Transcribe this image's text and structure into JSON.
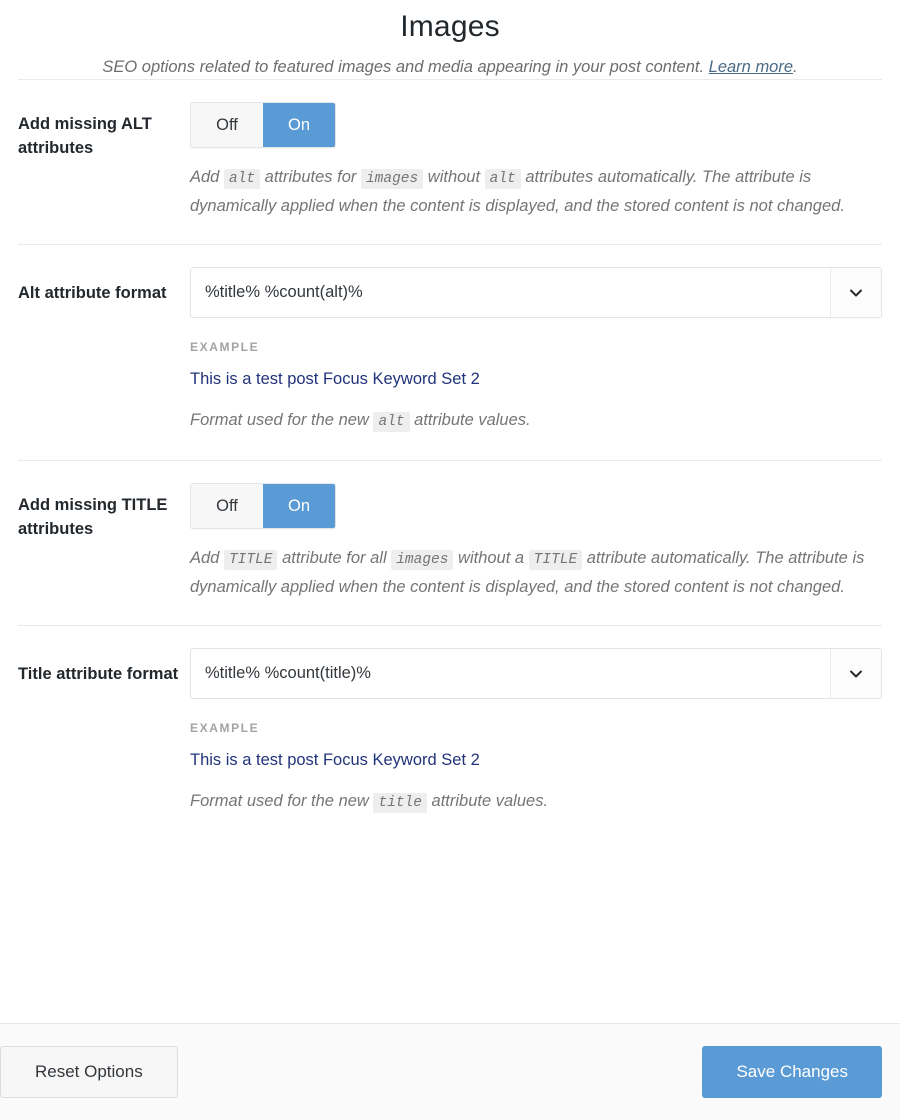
{
  "header": {
    "title": "Images",
    "subtitle_before": "SEO options related to featured images and media appearing in your post content.",
    "link_label": "Learn more",
    "subtitle_after": "."
  },
  "sections": {
    "alt_toggle": {
      "label": "Add missing ALT attributes",
      "off_label": "Off",
      "on_label": "On",
      "value": "On",
      "desc_1": "Add",
      "desc_code_1": "alt",
      "desc_2": "attributes for",
      "desc_code_2": "images",
      "desc_3": "without",
      "desc_code_3": "alt",
      "desc_4": "attributes automatically. The attribute is dynamically applied when the content is displayed, and the stored content is not changed."
    },
    "alt_format": {
      "label": "Alt attribute format",
      "value": "%title% %count(alt)%",
      "placeholder": "%title% %count(alt)%",
      "example_label": "EXAMPLE",
      "example_value": "This is a test post Focus Keyword Set 2",
      "desc_1": "Format used for the new",
      "desc_code_1": "alt",
      "desc_2": "attribute values."
    },
    "title_toggle": {
      "label": "Add missing TITLE attributes",
      "off_label": "Off",
      "on_label": "On",
      "value": "On",
      "desc_1": "Add",
      "desc_code_1": "TITLE",
      "desc_2": "attribute for all",
      "desc_code_2": "images",
      "desc_3": "without a",
      "desc_code_3": "TITLE",
      "desc_4": "attribute automatically. The attribute is dynamically applied when the content is displayed, and the stored content is not changed."
    },
    "title_format": {
      "label": "Title attribute format",
      "value": "%title% %count(title)%",
      "placeholder": "%title% %count(title)%",
      "example_label": "EXAMPLE",
      "example_value": "This is a test post Focus Keyword Set 2",
      "desc_1": "Format used for the new",
      "desc_code_1": "title",
      "desc_2": "attribute values."
    }
  },
  "footer": {
    "reset_label": "Reset Options",
    "save_label": "Save Changes"
  },
  "colors": {
    "accent_blue": "#5b9bd5",
    "example_text": "#21337a",
    "link": "#4a6a86"
  }
}
